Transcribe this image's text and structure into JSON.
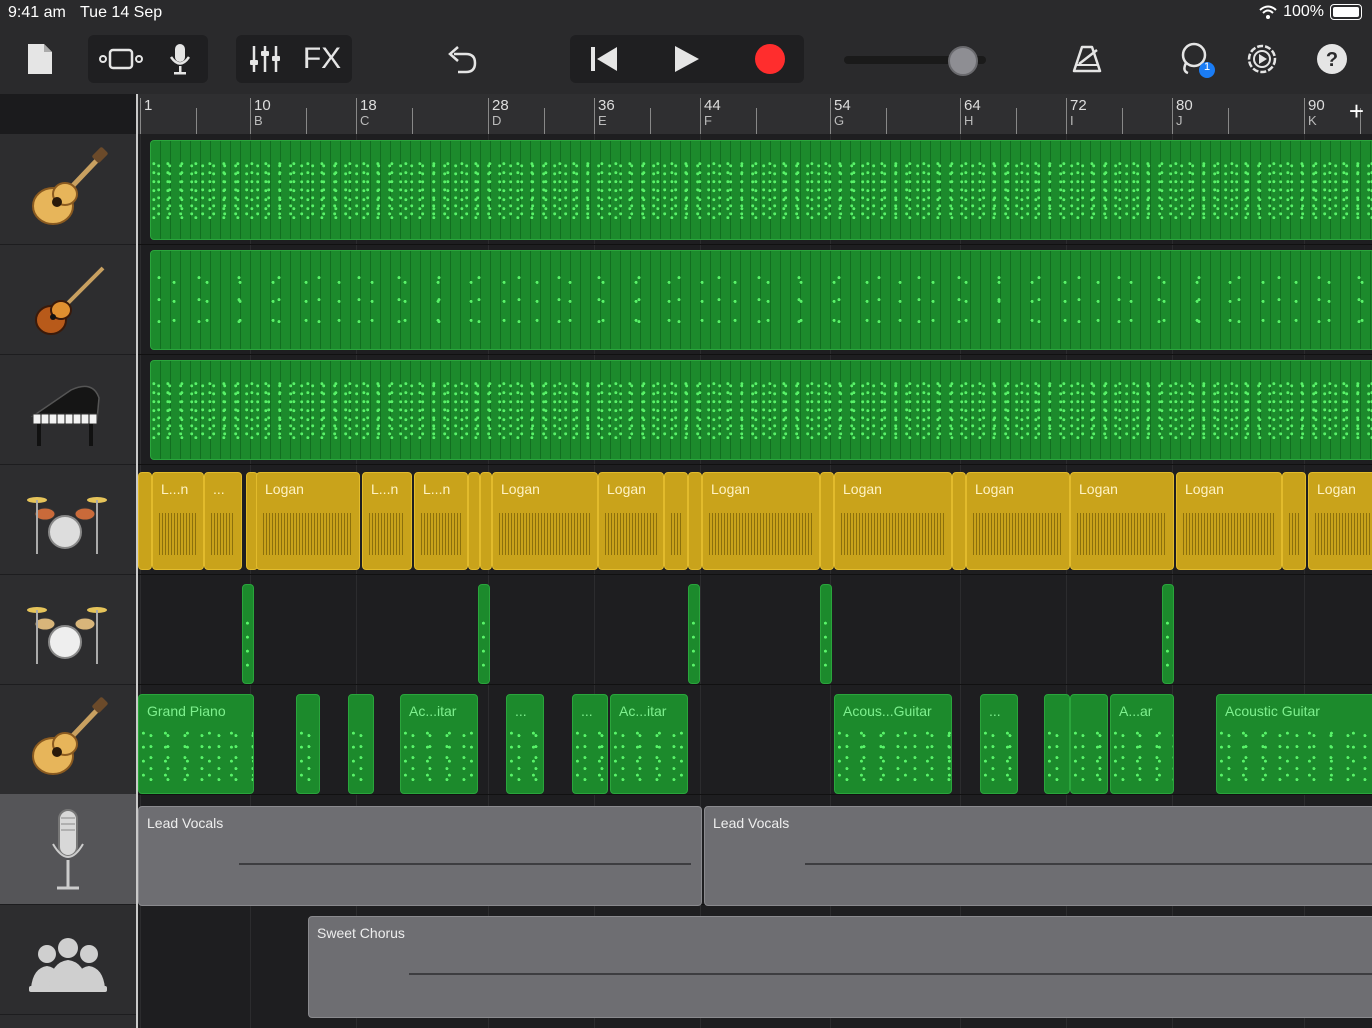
{
  "status": {
    "time": "9:41 am",
    "date": "Tue 14 Sep",
    "battery": "100%",
    "wifi_icon": "wifi-icon"
  },
  "toolbar": {
    "fx_label": "FX",
    "icons": [
      "document-icon",
      "tracks-view-icon",
      "microphone-icon",
      "mixer-icon",
      "undo-icon",
      "rewind-icon",
      "play-icon",
      "record-icon",
      "metronome-icon",
      "loop-icon",
      "settings-icon",
      "help-icon"
    ],
    "loop_badge": "1",
    "record_color": "#ff2d2d"
  },
  "ruler": {
    "marks": [
      {
        "num": "1",
        "letter": ""
      },
      {
        "num": "10",
        "letter": "B"
      },
      {
        "num": "18",
        "letter": "C"
      },
      {
        "num": "28",
        "letter": "D"
      },
      {
        "num": "36",
        "letter": "E"
      },
      {
        "num": "44",
        "letter": "F"
      },
      {
        "num": "54",
        "letter": "G"
      },
      {
        "num": "64",
        "letter": "H"
      },
      {
        "num": "72",
        "letter": "I"
      },
      {
        "num": "80",
        "letter": "J"
      },
      {
        "num": "90",
        "letter": "K"
      }
    ],
    "add_label": "+"
  },
  "tracks": [
    {
      "icon": "acoustic-guitar-icon",
      "regions": []
    },
    {
      "icon": "bass-guitar-icon",
      "regions": []
    },
    {
      "icon": "grand-piano-icon",
      "regions": []
    },
    {
      "icon": "drum-kit-icon",
      "regions": [
        "L...n",
        "...",
        "Logan",
        "L...n",
        "L...n",
        "Logan",
        "Logan",
        "Logan",
        "Logan",
        "Logan",
        "Logan",
        "Logan",
        "Logan"
      ]
    },
    {
      "icon": "drum-kit-icon",
      "regions": []
    },
    {
      "icon": "acoustic-guitar-icon",
      "regions": [
        "Grand Piano",
        "Ac...itar",
        "...",
        "...",
        "Ac...itar",
        "Acous...Guitar",
        "...",
        "A...ar",
        "Acoustic Guitar"
      ]
    },
    {
      "icon": "microphone-icon",
      "regions": [
        "Lead Vocals",
        "Lead Vocals"
      ]
    },
    {
      "icon": "choir-icon",
      "regions": [
        "Sweet Chorus"
      ]
    }
  ],
  "colors": {
    "midi": "#1c8a2c",
    "audio": "#c9a31b",
    "vocal": "#6e6e72"
  }
}
